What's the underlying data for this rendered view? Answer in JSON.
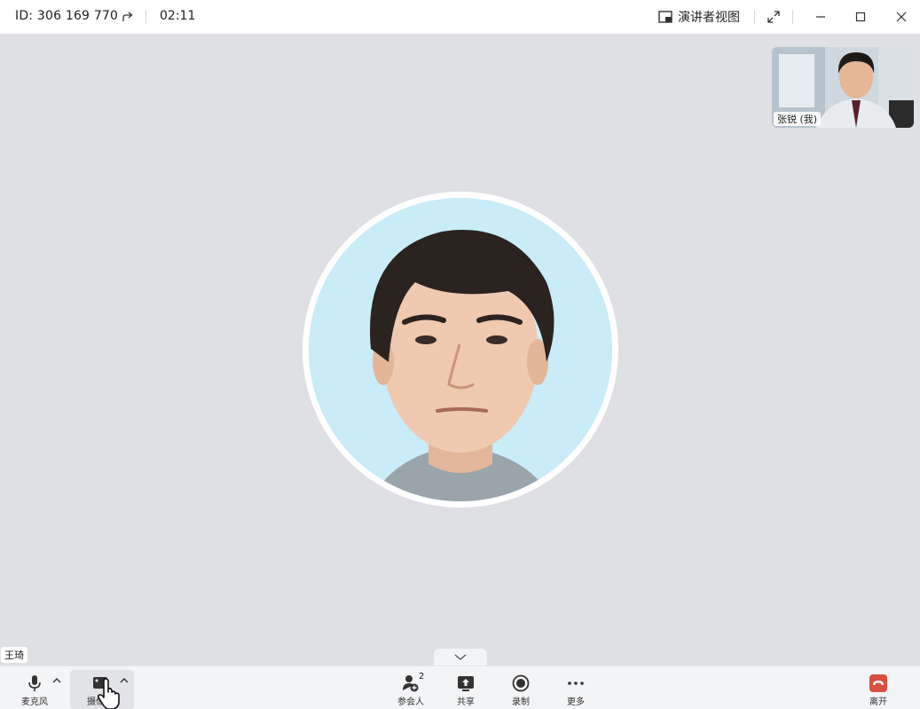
{
  "titlebar": {
    "meeting_id": "ID:  306 169 770",
    "timer": "02:11",
    "presenter_view_label": "演讲者视图"
  },
  "stage": {
    "speaker_name": "王琦",
    "self_view_name": "张锐 (我)"
  },
  "toolbar": {
    "mic_label": "麦克风",
    "camera_label": "摄像头",
    "participants_label": "参会人",
    "participants_count": "2",
    "share_label": "共享",
    "record_label": "录制",
    "more_label": "更多",
    "leave_label": "离开"
  },
  "colors": {
    "stage_bg": "#dee0e3",
    "avatar_bg": "#c9ecf8",
    "leave_red": "#d9503f",
    "icon_dark": "#333333"
  }
}
